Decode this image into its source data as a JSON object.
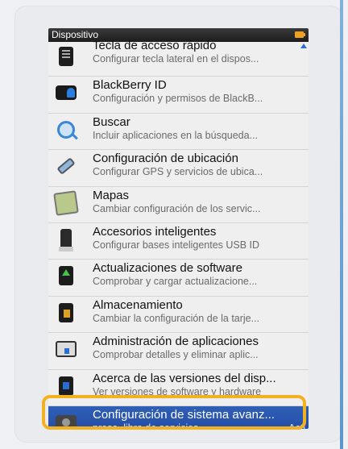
{
  "statusbar": {
    "title": "Dispositivo"
  },
  "items": [
    {
      "title": "Tecla de acceso rápido",
      "sub": "Configurar tecla lateral en el dispos...",
      "icon": "device-key-icon"
    },
    {
      "title": "BlackBerry ID",
      "sub": "Configuración y permisos de BlackB...",
      "icon": "blackberry-id-icon"
    },
    {
      "title": "Buscar",
      "sub": "Incluir aplicaciones en la búsqueda...",
      "icon": "search-icon"
    },
    {
      "title": "Configuración de ubicación",
      "sub": "Configurar GPS y servicios de ubica...",
      "icon": "satellite-icon"
    },
    {
      "title": "Mapas",
      "sub": "Cambiar configuración de los servic...",
      "icon": "map-icon"
    },
    {
      "title": "Accesorios inteligentes",
      "sub": "Configurar bases inteligentes USB ID",
      "icon": "dock-icon"
    },
    {
      "title": "Actualizaciones de software",
      "sub": "Comprobar y cargar actualizacione...",
      "icon": "software-update-icon"
    },
    {
      "title": "Almacenamiento",
      "sub": "Cambiar la configuración de la tarje...",
      "icon": "storage-icon"
    },
    {
      "title": "Administración de aplicaciones",
      "sub": "Comprobar detalles y eliminar aplic...",
      "icon": "app-management-icon"
    },
    {
      "title": "Acerca de las versiones del disp...",
      "sub": "Ver versiones de software y hardware",
      "icon": "info-icon"
    },
    {
      "title": "Configuración de sistema avanz...",
      "sub": "presa, libro de servicios",
      "sub_right": "Acti",
      "icon": "advanced-settings-icon"
    }
  ],
  "colors": {
    "highlight": "#f2b21f",
    "selected": "#2f5fb6"
  }
}
